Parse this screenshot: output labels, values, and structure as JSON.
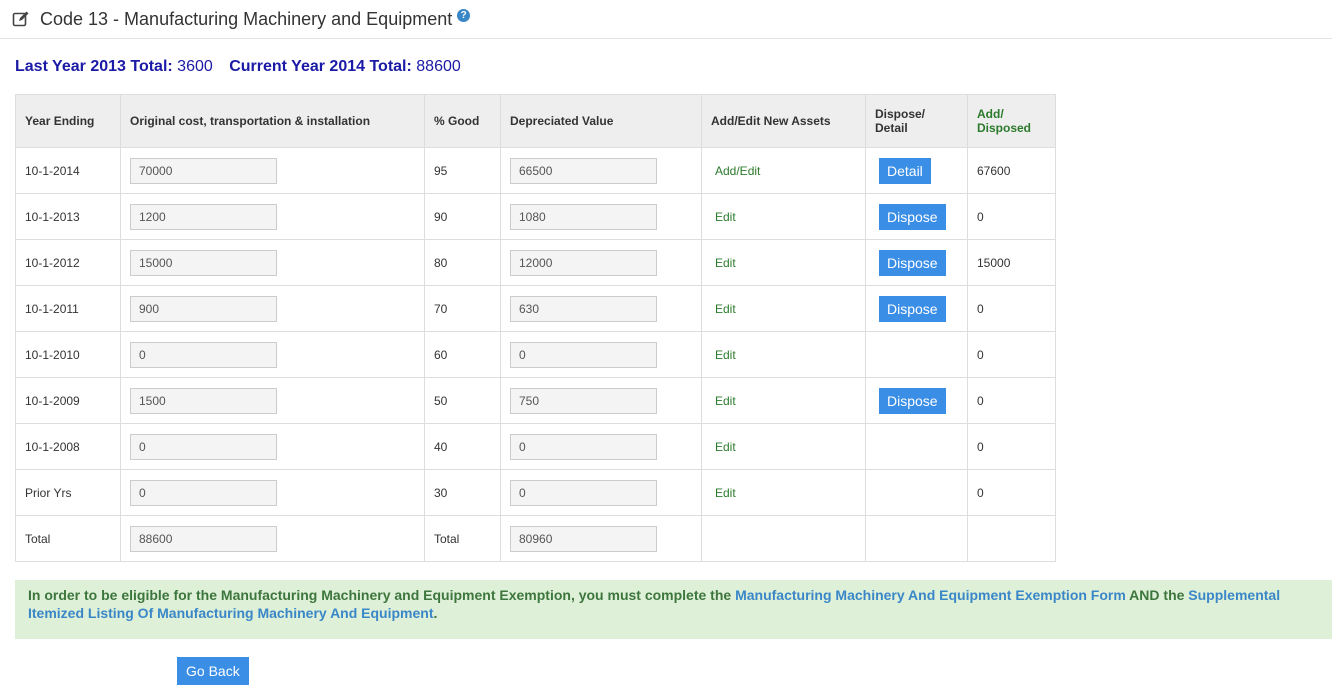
{
  "header": {
    "title": "Code 13 - Manufacturing Machinery and Equipment",
    "help_icon": "question-circle-icon",
    "edit_icon": "edit-square-icon"
  },
  "totals": {
    "last_label": "Last Year 2013 Total:",
    "last_value": "3600",
    "current_label": "Current Year 2014 Total:",
    "current_value": "88600"
  },
  "table": {
    "headers": [
      "Year Ending",
      "Original cost, transportation & installation",
      "% Good",
      "Depreciated Value",
      "Add/Edit New Assets",
      "Dispose/ Detail",
      "Add/ Disposed"
    ],
    "rows": [
      {
        "year": "10-1-2014",
        "cost": "70000",
        "good": "95",
        "dep": "66500",
        "edit": "Add/Edit",
        "action": "Detail",
        "added": "67600"
      },
      {
        "year": "10-1-2013",
        "cost": "1200",
        "good": "90",
        "dep": "1080",
        "edit": "Edit",
        "action": "Dispose",
        "added": "0"
      },
      {
        "year": "10-1-2012",
        "cost": "15000",
        "good": "80",
        "dep": "12000",
        "edit": "Edit",
        "action": "Dispose",
        "added": "15000"
      },
      {
        "year": "10-1-2011",
        "cost": "900",
        "good": "70",
        "dep": "630",
        "edit": "Edit",
        "action": "Dispose",
        "added": "0"
      },
      {
        "year": "10-1-2010",
        "cost": "0",
        "good": "60",
        "dep": "0",
        "edit": "Edit",
        "action": "",
        "added": "0"
      },
      {
        "year": "10-1-2009",
        "cost": "1500",
        "good": "50",
        "dep": "750",
        "edit": "Edit",
        "action": "Dispose",
        "added": "0"
      },
      {
        "year": "10-1-2008",
        "cost": "0",
        "good": "40",
        "dep": "0",
        "edit": "Edit",
        "action": "",
        "added": "0"
      },
      {
        "year": "Prior Yrs",
        "cost": "0",
        "good": "30",
        "dep": "0",
        "edit": "Edit",
        "action": "",
        "added": "0"
      }
    ],
    "total": {
      "label": "Total",
      "cost": "88600",
      "label2": "Total",
      "dep": "80960"
    }
  },
  "notice": {
    "text_before": "In order to be eligible for the Manufacturing Machinery and Equipment Exemption, you must complete the ",
    "link1": "Manufacturing Machinery And Equipment Exemption Form",
    "text_middle": " AND the ",
    "link2": "Supplemental Itemized Listing Of Manufacturing Machinery And Equipment",
    "text_after": "."
  },
  "go_back_label": "Go Back",
  "colors": {
    "accent": "#3a8ee6",
    "green": "#2c7a2c",
    "navy": "#1a1aa6",
    "notice_bg": "#dff0d8"
  }
}
